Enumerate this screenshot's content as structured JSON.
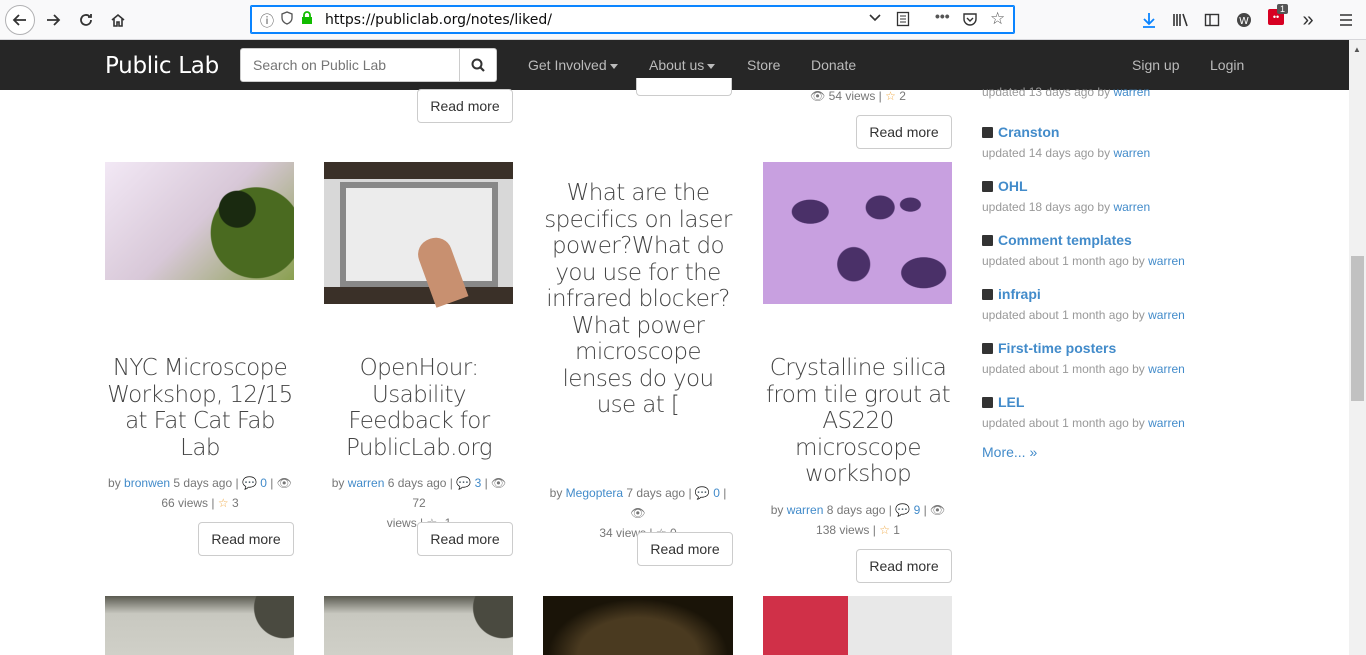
{
  "browser": {
    "url": "https://publiclab.org/notes/liked/",
    "badge_count": "1"
  },
  "navbar": {
    "brand": "Public Lab",
    "search_placeholder": "Search on Public Lab",
    "links": [
      "Get Involved",
      "About us",
      "Store",
      "Donate"
    ],
    "signup": "Sign up",
    "login": "Login"
  },
  "top_row": {
    "read_more": "Read more",
    "card4_meta": "54 views | ",
    "card4_likes": "2"
  },
  "cards": [
    {
      "title": "NYC Microscope Workshop, 12/15 at Fat Cat Fab Lab",
      "author": "bronwen",
      "age": "5 days ago",
      "comments": "0",
      "views": "66 views",
      "likes": "3",
      "read_more": "Read more"
    },
    {
      "title": "OpenHour: Usability Feedback for PublicLab.org",
      "author": "warren",
      "age": "6 days ago",
      "comments": "3",
      "views_num": "72",
      "views": "views",
      "likes": "-1",
      "read_more": "Read more"
    },
    {
      "title": "What are the specifics on laser power?What do you use for the infrared blocker?What power microscope lenses do you use at [",
      "author": "Megoptera",
      "age": "7 days ago",
      "comments": "0",
      "views": "34 views",
      "likes": "0",
      "read_more": "Read more"
    },
    {
      "title": "Crystalline silica from tile grout at AS220 microscope workshop",
      "author": "warren",
      "age": "8 days ago",
      "comments": "9",
      "views": "138 views",
      "likes": "1",
      "read_more": "Read more"
    }
  ],
  "sidebar": {
    "top_sub": "updated 13 days ago by",
    "top_user": "warren",
    "items": [
      {
        "title": "Cranston",
        "sub": "updated 14 days ago by",
        "user": "warren"
      },
      {
        "title": "OHL",
        "sub": "updated 18 days ago by",
        "user": "warren"
      },
      {
        "title": "Comment templates",
        "sub": "updated about 1 month ago by",
        "user": "warren"
      },
      {
        "title": "infrapi",
        "sub": "updated about 1 month ago by",
        "user": "warren"
      },
      {
        "title": "First-time posters",
        "sub": "updated about 1 month ago by",
        "user": "warren"
      },
      {
        "title": "LEL",
        "sub": "updated about 1 month ago by",
        "user": "warren"
      }
    ],
    "more": "More... »"
  },
  "colors": {
    "accent": "#428bca",
    "navbar": "#262626",
    "star": "#f0ad4e"
  }
}
